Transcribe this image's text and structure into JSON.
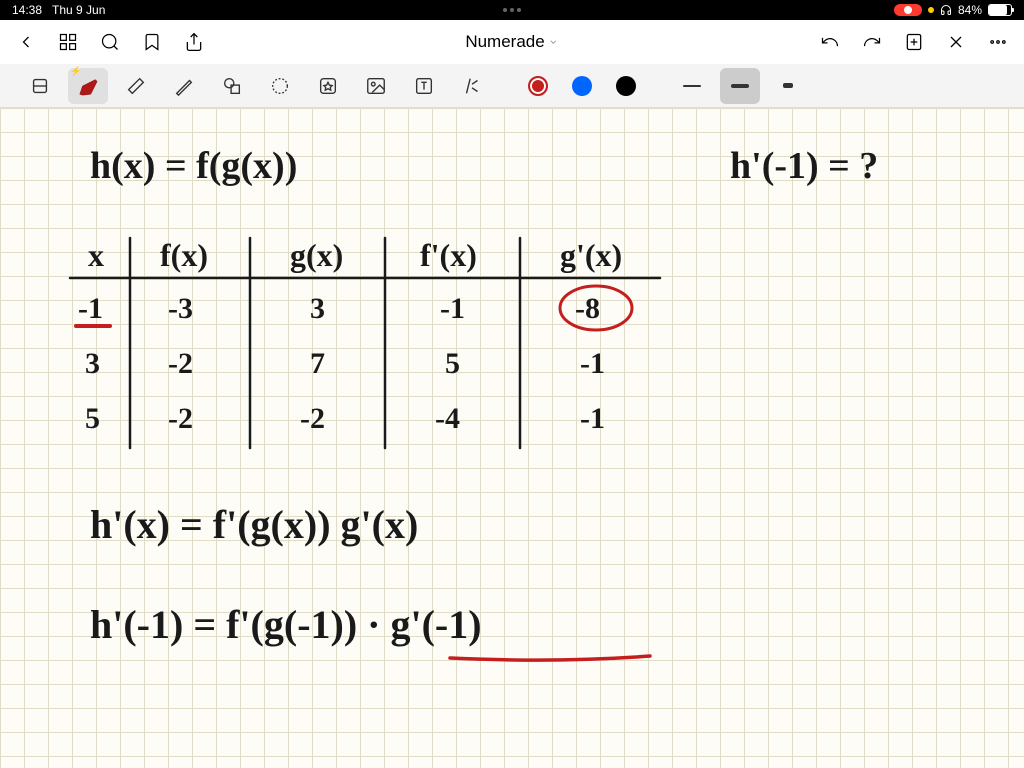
{
  "status": {
    "time": "14:38",
    "date": "Thu 9 Jun",
    "battery_pct": "84%"
  },
  "nav": {
    "title": "Numerade"
  },
  "handwriting": {
    "eq1": "h(x) = f(g(x))",
    "eq2": "h'(-1) = ?",
    "headers": {
      "c0": "x",
      "c1": "f(x)",
      "c2": "g(x)",
      "c3": "f'(x)",
      "c4": "g'(x)"
    },
    "rows": [
      {
        "c0": "-1",
        "c1": "-3",
        "c2": "3",
        "c3": "-1",
        "c4": "-8"
      },
      {
        "c0": "3",
        "c1": "-2",
        "c2": "7",
        "c3": "5",
        "c4": "-1"
      },
      {
        "c0": "5",
        "c1": "-2",
        "c2": "-2",
        "c3": "-4",
        "c4": "-1"
      }
    ],
    "eq3": "h'(x) = f'(g(x)) g'(x)",
    "eq4": "h'(-1) = f'(g(-1)) · g'(-1)"
  },
  "colors": {
    "ink": "#1a1a1a",
    "red": "#c41e1e"
  }
}
